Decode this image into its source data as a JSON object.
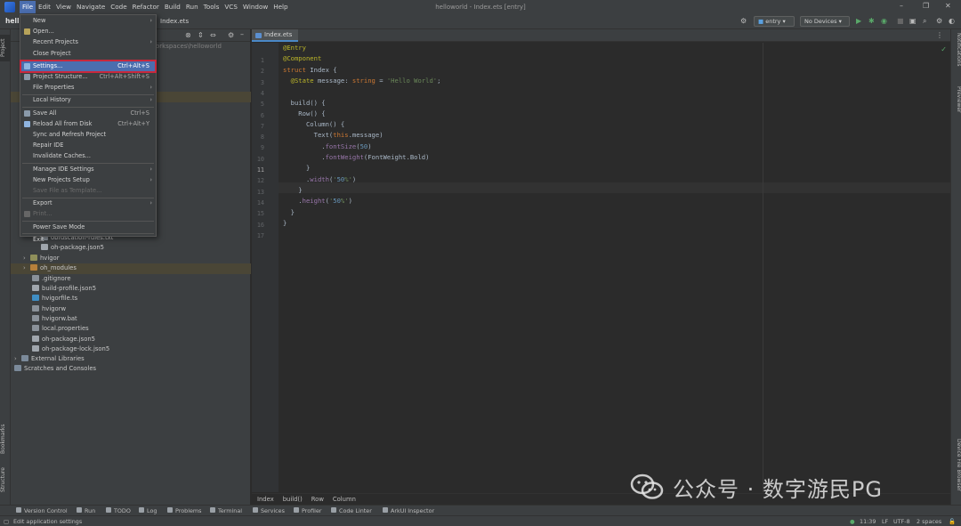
{
  "window": {
    "title": "helloworld - Index.ets [entry]"
  },
  "menubar": {
    "items": [
      "File",
      "Edit",
      "View",
      "Navigate",
      "Code",
      "Refactor",
      "Build",
      "Run",
      "Tools",
      "VCS",
      "Window",
      "Help"
    ],
    "active": "File"
  },
  "toolbar": {
    "project_name": "hell",
    "current_file": "Index.ets",
    "module_combo": "entry",
    "device_combo": "No Devices"
  },
  "project_panel": {
    "path_suffix": "orkspaces\\helloworld",
    "tree": [
      {
        "label": "obfuscation-rules.txt",
        "icon": "file"
      },
      {
        "label": "oh-package.json5",
        "icon": "json"
      },
      {
        "label": "hvigor",
        "icon": "folder"
      },
      {
        "label": "oh_modules",
        "icon": "folder-orange"
      },
      {
        "label": ".gitignore",
        "icon": "file"
      },
      {
        "label": "build-profile.json5",
        "icon": "json"
      },
      {
        "label": "hvigorfile.ts",
        "icon": "ts"
      },
      {
        "label": "hvigorw",
        "icon": "file"
      },
      {
        "label": "hvigorw.bat",
        "icon": "file"
      },
      {
        "label": "local.properties",
        "icon": "file"
      },
      {
        "label": "oh-package.json5",
        "icon": "json"
      },
      {
        "label": "oh-package-lock.json5",
        "icon": "json"
      },
      {
        "label": "External Libraries",
        "icon": "lib"
      },
      {
        "label": "Scratches and Consoles",
        "icon": "lib"
      }
    ]
  },
  "file_menu": {
    "items": [
      {
        "label": "New",
        "submenu": true
      },
      {
        "label": "Open...",
        "icon": "folder"
      },
      {
        "label": "Recent Projects",
        "submenu": true
      },
      {
        "label": "Close Project"
      },
      {
        "separator": true
      },
      {
        "label": "Settings...",
        "shortcut": "Ctrl+Alt+S",
        "selected": true,
        "icon": "wrench"
      },
      {
        "label": "Project Structure...",
        "shortcut": "Ctrl+Alt+Shift+S",
        "icon": "structure"
      },
      {
        "label": "File Properties",
        "submenu": true
      },
      {
        "separator": true
      },
      {
        "label": "Local History",
        "submenu": true
      },
      {
        "separator": true
      },
      {
        "label": "Save All",
        "shortcut": "Ctrl+S",
        "icon": "save"
      },
      {
        "label": "Reload All from Disk",
        "shortcut": "Ctrl+Alt+Y",
        "icon": "reload"
      },
      {
        "label": "Sync and Refresh Project"
      },
      {
        "label": "Repair IDE"
      },
      {
        "label": "Invalidate Caches..."
      },
      {
        "separator": true
      },
      {
        "label": "Manage IDE Settings",
        "submenu": true
      },
      {
        "label": "New Projects Setup",
        "submenu": true
      },
      {
        "label": "Save File as Template...",
        "disabled": true
      },
      {
        "separator": true
      },
      {
        "label": "Export",
        "submenu": true
      },
      {
        "label": "Print...",
        "disabled": true,
        "icon": "print"
      },
      {
        "separator": true
      },
      {
        "label": "Power Save Mode"
      },
      {
        "separator": true
      },
      {
        "label": "Exit"
      }
    ]
  },
  "editor": {
    "tab": "Index.ets",
    "current_line": 11,
    "lines": [
      "@Entry",
      "@Component",
      "struct Index {",
      "  @State message: string = 'Hello World';",
      "",
      "  build() {",
      "    Row() {",
      "      Column() {",
      "        Text(this.message)",
      "          .fontSize(50)",
      "          .fontWeight(FontWeight.Bold)",
      "      }",
      "      .width('50%')",
      "    }",
      "    .height('50%')",
      "  }",
      "}"
    ],
    "breadcrumb": [
      "Index",
      "build()",
      "Row",
      "Column"
    ]
  },
  "left_strip": {
    "top": "Project",
    "bottom1": "Bookmarks",
    "bottom2": "Structure"
  },
  "right_strip": {
    "top1": "Notifications",
    "top2": "Previewer",
    "bottom": "Device File Browser"
  },
  "bottom_tools": [
    "Version Control",
    "Run",
    "TODO",
    "Log",
    "Problems",
    "Terminal",
    "Services",
    "Profiler",
    "Code Linter",
    "ArkUI Inspector"
  ],
  "status_bar": {
    "message": "Edit application settings",
    "position": "11:39",
    "line_ending": "LF",
    "encoding": "UTF-8",
    "indent": "2 spaces"
  },
  "watermark": {
    "text": "公众号 · 数字游民PG"
  },
  "colors": {
    "accent": "#4b6eaf",
    "highlight_border": "#c8283c",
    "editor_bg": "#2b2b2b",
    "panel_bg": "#3c3f41"
  }
}
